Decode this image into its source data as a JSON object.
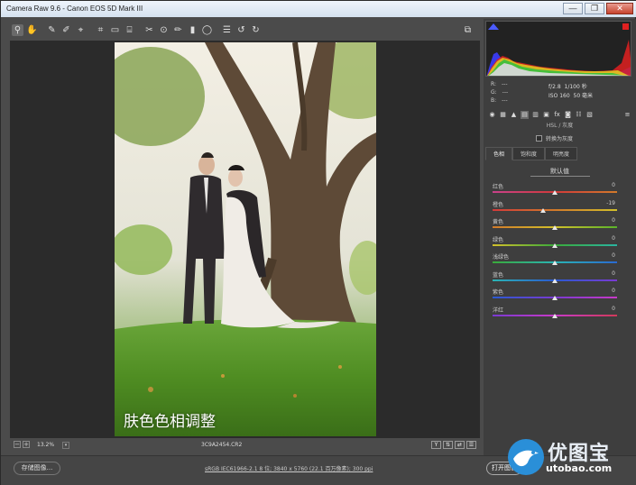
{
  "window": {
    "title": "Camera Raw 9.6 - Canon EOS 5D Mark III",
    "min": "—",
    "max": "❐",
    "close": "✕"
  },
  "toolbar": {
    "tools": [
      "zoom-icon",
      "hand-icon",
      "white-balance-icon",
      "color-sampler-icon",
      "target-adjust-icon",
      "crop-icon",
      "straighten-icon",
      "transform-icon",
      "spot-removal-icon",
      "red-eye-icon",
      "adjustment-brush-icon",
      "graduated-filter-icon",
      "radial-filter-icon",
      "preferences-icon",
      "rotate-left-icon",
      "rotate-right-icon"
    ],
    "fullscreen_icon": "fullscreen-icon"
  },
  "canvas": {
    "caption": "肤色色相调整"
  },
  "status": {
    "zoom_out": "−",
    "zoom_in": "+",
    "zoom": "13.2%",
    "filename": "3C9A2454.CR2"
  },
  "bottom": {
    "save_label": "存储图像...",
    "workflow": "sRGB IEC61966-2.1 8 位; 3840 x 5760 (22.1 百万像素); 300 ppi",
    "open_label": "打开图像"
  },
  "panel": {
    "readout": {
      "r_label": "R:",
      "r_val": "---",
      "g_label": "G:",
      "g_val": "---",
      "b_label": "B:",
      "b_val": "---"
    },
    "camera": {
      "aperture": "f/2.8",
      "shutter": "1/100 秒",
      "iso": "ISO 160",
      "focal": "50 毫米"
    },
    "title": "HSL / 灰度",
    "grayscale_label": "转换为灰度",
    "tabs": [
      "色相",
      "饱和度",
      "明亮度"
    ],
    "subheading": "默认值",
    "sliders": [
      {
        "label": "红色",
        "value": "0",
        "pos": 0.5
      },
      {
        "label": "橙色",
        "value": "-19",
        "pos": 0.405
      },
      {
        "label": "黄色",
        "value": "0",
        "pos": 0.5
      },
      {
        "label": "绿色",
        "value": "0",
        "pos": 0.5
      },
      {
        "label": "浅绿色",
        "value": "0",
        "pos": 0.5
      },
      {
        "label": "蓝色",
        "value": "0",
        "pos": 0.5
      },
      {
        "label": "紫色",
        "value": "0",
        "pos": 0.5
      },
      {
        "label": "洋红",
        "value": "0",
        "pos": 0.5
      }
    ]
  },
  "watermark": {
    "brand": "优图宝",
    "url": "utobao.com"
  }
}
